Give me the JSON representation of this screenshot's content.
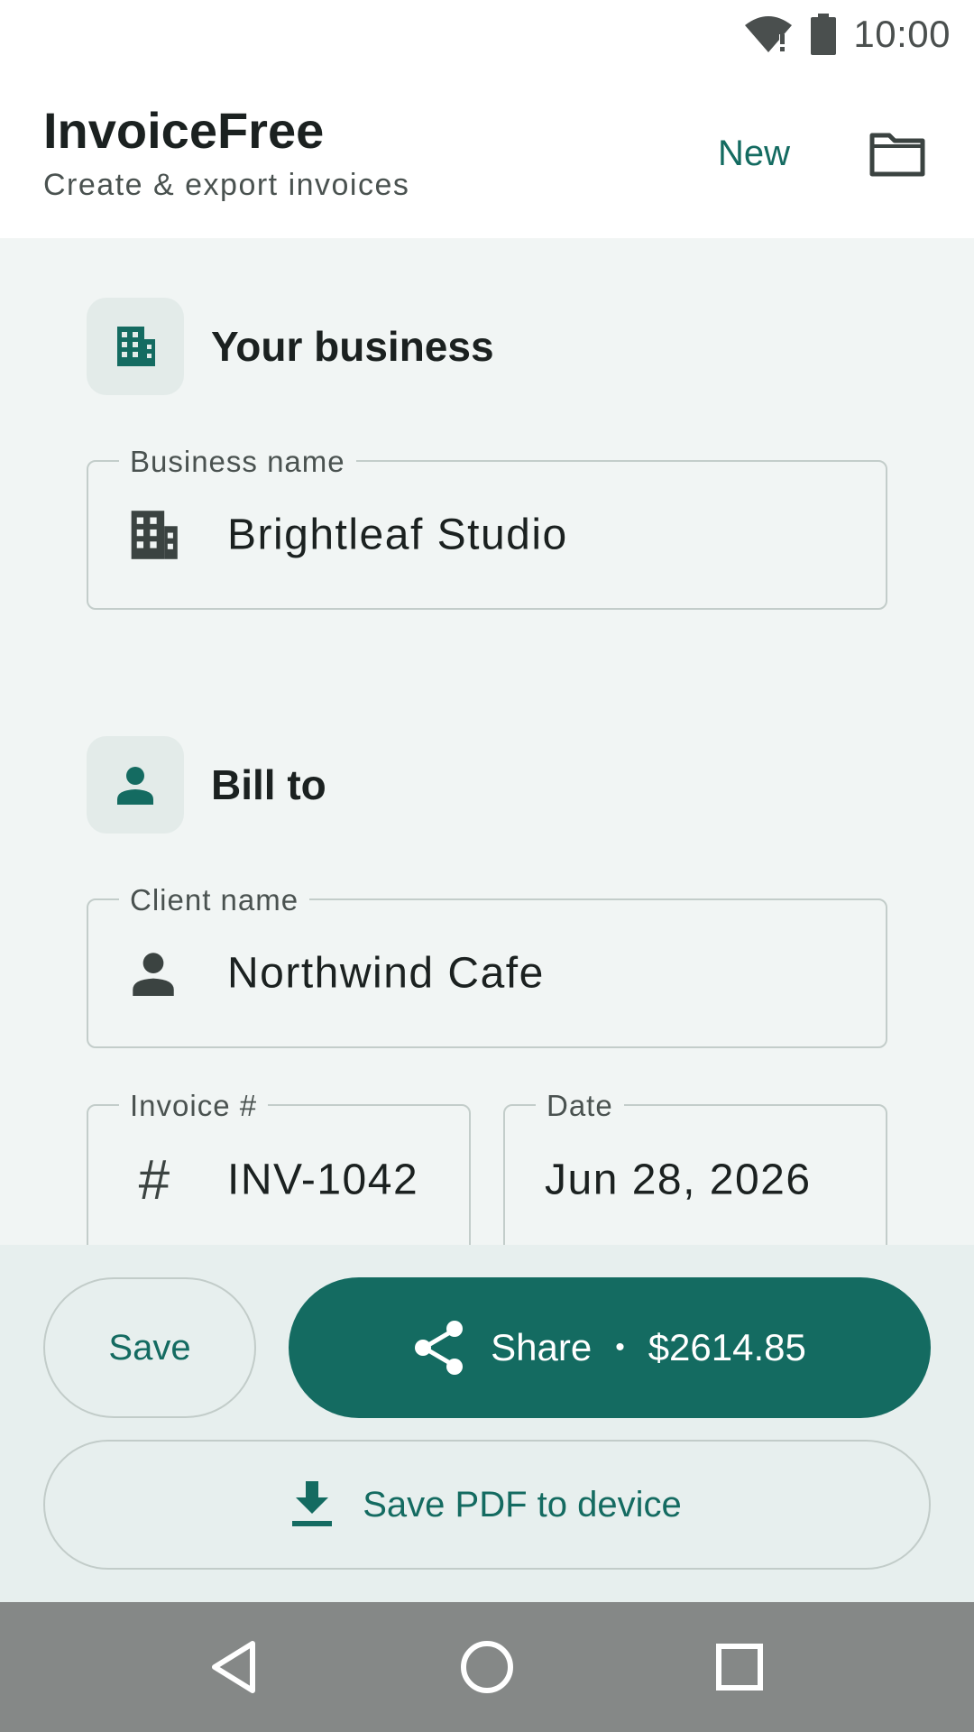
{
  "status_bar": {
    "time": "10:00",
    "icons": [
      "wifi-alert-icon",
      "battery-icon"
    ]
  },
  "app_bar": {
    "title": "InvoiceFree",
    "subtitle": "Create & export invoices",
    "new_label": "New",
    "folder_icon": "folder-icon"
  },
  "business_card": {
    "title": "Your business",
    "icon": "building-icon",
    "business_name": {
      "label": "Business name",
      "value": "Brightleaf Studio",
      "icon": "building-icon"
    }
  },
  "bill_to_card": {
    "title": "Bill to",
    "icon": "person-icon",
    "client_name": {
      "label": "Client name",
      "value": "Northwind Cafe",
      "icon": "person-icon"
    },
    "invoice_number": {
      "label": "Invoice #",
      "value": "INV-1042",
      "icon": "#"
    },
    "date": {
      "label": "Date",
      "value": "Jun 28, 2026"
    }
  },
  "actions": {
    "save_label": "Save",
    "share_label": "Share",
    "share_separator": "•",
    "share_total": "$2614.85",
    "pdf_label": "Save PDF to device"
  },
  "colors": {
    "accent": "#146b61",
    "background": "#f1f5f4",
    "chip": "#e3ebe9",
    "nav_bar": "#858887"
  },
  "nav": {
    "icons": [
      "back-icon",
      "home-icon",
      "recents-icon"
    ]
  }
}
